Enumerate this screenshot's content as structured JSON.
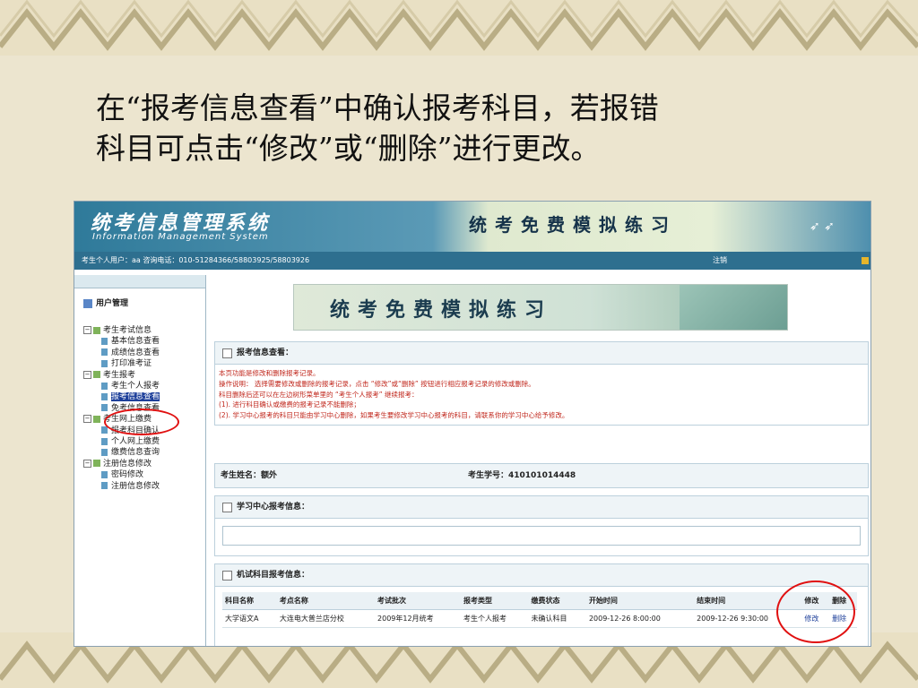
{
  "slide": {
    "headline_line1": "在“报考信息查看”中确认报考科目，若报错",
    "headline_line2": "科目可点击“修改”或“删除”进行更改。"
  },
  "app": {
    "brand_cn": "统考信息管理系统",
    "brand_en": "Information Management System",
    "banner_title": "统考免费模拟练习",
    "status_user": "考生个人用户：aa 咨询电话：010-51284366/58803925/58803926",
    "logout_label": "注销"
  },
  "sidebar": {
    "heading": "用户管理",
    "groups": [
      {
        "label": "考生考试信息",
        "items": [
          "基本信息查看",
          "成绩信息查看",
          "打印准考证"
        ]
      },
      {
        "label": "考生报考",
        "items": [
          "考生个人报考",
          "报考信息查看",
          "免考信息查看"
        ]
      },
      {
        "label": "考生网上缴费",
        "items": [
          "报考科目确认",
          "个人网上缴费",
          "缴费信息查询"
        ]
      },
      {
        "label": "注册信息修改",
        "items": [
          "密码修改",
          "注册信息修改"
        ]
      }
    ]
  },
  "main": {
    "ad_title": "统考免费模拟练习",
    "section_title": "报考信息查看：",
    "notes": [
      "本页功能是修改和删除报考记录。",
      "操作说明： 选择需要修改或删除的报考记录，点击 “修改”或“删除” 按钮进行相应报考记录的修改或删除。",
      "科目删除后还可以在左边树形菜单里的 “考生个人报考” 继续报考：",
      "(1). 进行科目确认或缴费的报考记录不能删除；",
      "(2). 学习中心报考的科目只能由学习中心删除，如果考生要修改学习中心报考的科目，请联系你的学习中心给予修改。"
    ],
    "student_name_label": "考生姓名：额外",
    "student_id_label": "考生学号：410101014448",
    "center_title": "学习中心报考信息：",
    "exam_title": "机试科目报考信息：",
    "table": {
      "headers": [
        "科目名称",
        "考点名称",
        "考试批次",
        "报考类型",
        "缴费状态",
        "开始时间",
        "结束时间",
        "修改",
        "删除"
      ],
      "rows": [
        [
          "大学语文A",
          "大连电大普兰店分校",
          "2009年12月统考",
          "考生个人报考",
          "未确认科目",
          "2009-12-26 8:00:00",
          "2009-12-26 9:30:00",
          "修改",
          "删除"
        ]
      ]
    }
  }
}
